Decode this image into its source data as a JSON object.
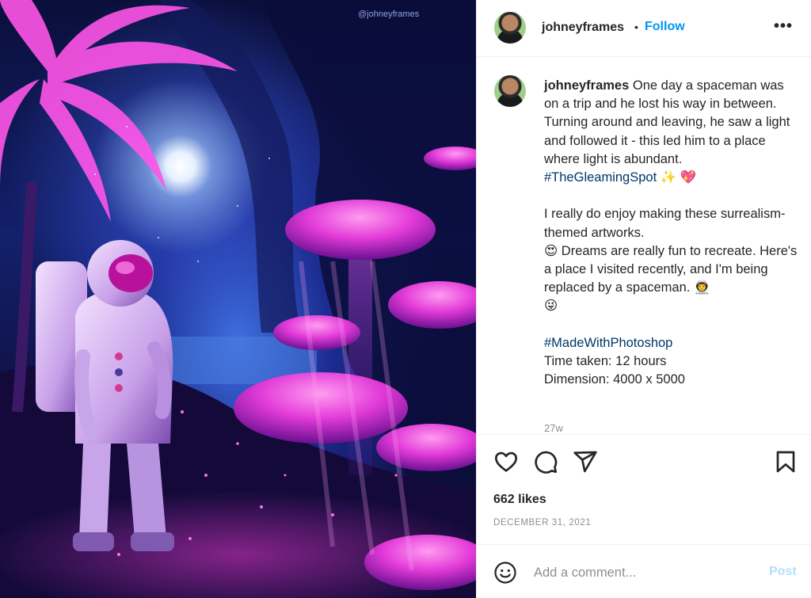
{
  "media": {
    "watermark": "@johneyframes"
  },
  "header": {
    "username": "johneyframes",
    "separator": "•",
    "follow_label": "Follow",
    "more_label": "•••"
  },
  "caption": {
    "username": "johneyframes",
    "line1": "One day a spaceman was on a trip and he lost his way in between.",
    "line2": "Turning around and leaving, he saw a light and followed it - this led him to a place where light is abundant.",
    "tag1": "#TheGleamingSpot",
    "tag1_emojis": "✨ 💖",
    "para2_a": "I really do enjoy making these surrealism-themed artworks.",
    "para2_b": "😍 Dreams are really fun to recreate. Here's a place I visited recently, and I'm being replaced by a spaceman. 👨‍🚀",
    "para2_c": "😜",
    "tag2": "#MadeWithPhotoshop",
    "time_taken": "Time taken: 12 hours",
    "dimension": "Dimension: 4000 x 5000",
    "time_ago": "27w"
  },
  "actions": {
    "likes": "662 likes",
    "date": "DECEMBER 31, 2021"
  },
  "comment_bar": {
    "placeholder": "Add a comment...",
    "post_label": "Post"
  },
  "colors": {
    "follow": "#0095f6",
    "hashtag": "#00376b",
    "post_disabled": "#b2dffc",
    "muted": "#8e8e8e"
  }
}
